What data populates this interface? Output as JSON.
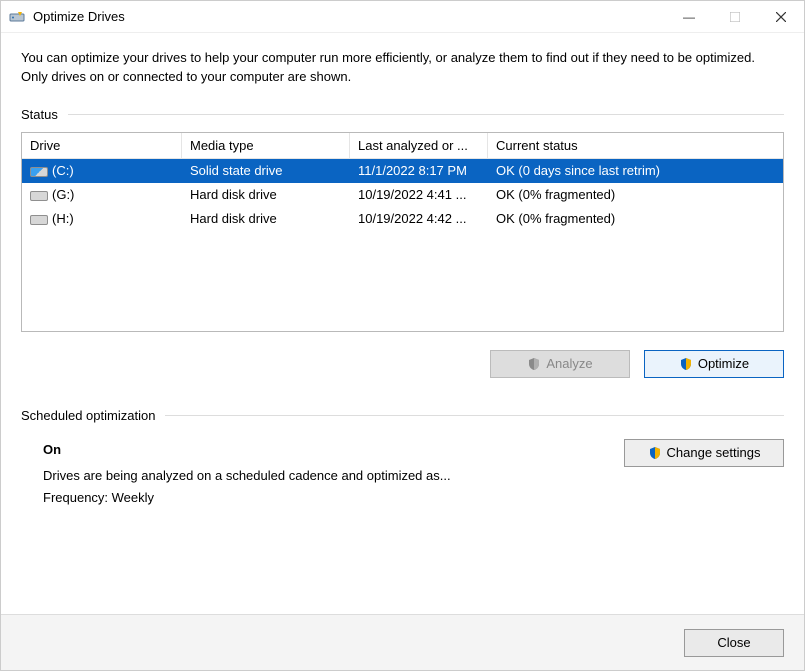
{
  "window": {
    "title": "Optimize Drives",
    "minimize_glyph": "—",
    "maximize_glyph": "□",
    "close_glyph": "✕"
  },
  "intro": "You can optimize your drives to help your computer run more efficiently, or analyze them to find out if they need to be optimized. Only drives on or connected to your computer are shown.",
  "status": {
    "label": "Status",
    "columns": {
      "drive": "Drive",
      "media": "Media type",
      "last": "Last analyzed or ...",
      "status": "Current status"
    },
    "rows": [
      {
        "drive": "(C:)",
        "media": "Solid state drive",
        "last": "11/1/2022 8:17 PM",
        "status": "OK (0 days since last retrim)",
        "selected": true,
        "icon": "windows"
      },
      {
        "drive": "(G:)",
        "media": "Hard disk drive",
        "last": "10/19/2022 4:41 ...",
        "status": "OK (0% fragmented)",
        "selected": false,
        "icon": "hdd"
      },
      {
        "drive": "(H:)",
        "media": "Hard disk drive",
        "last": "10/19/2022 4:42 ...",
        "status": "OK (0% fragmented)",
        "selected": false,
        "icon": "hdd"
      }
    ]
  },
  "buttons": {
    "analyze": "Analyze",
    "optimize": "Optimize",
    "change_settings": "Change settings",
    "close": "Close"
  },
  "scheduled": {
    "label": "Scheduled optimization",
    "on": "On",
    "desc": "Drives are being analyzed on a scheduled cadence and optimized as...",
    "freq": "Frequency: Weekly"
  }
}
